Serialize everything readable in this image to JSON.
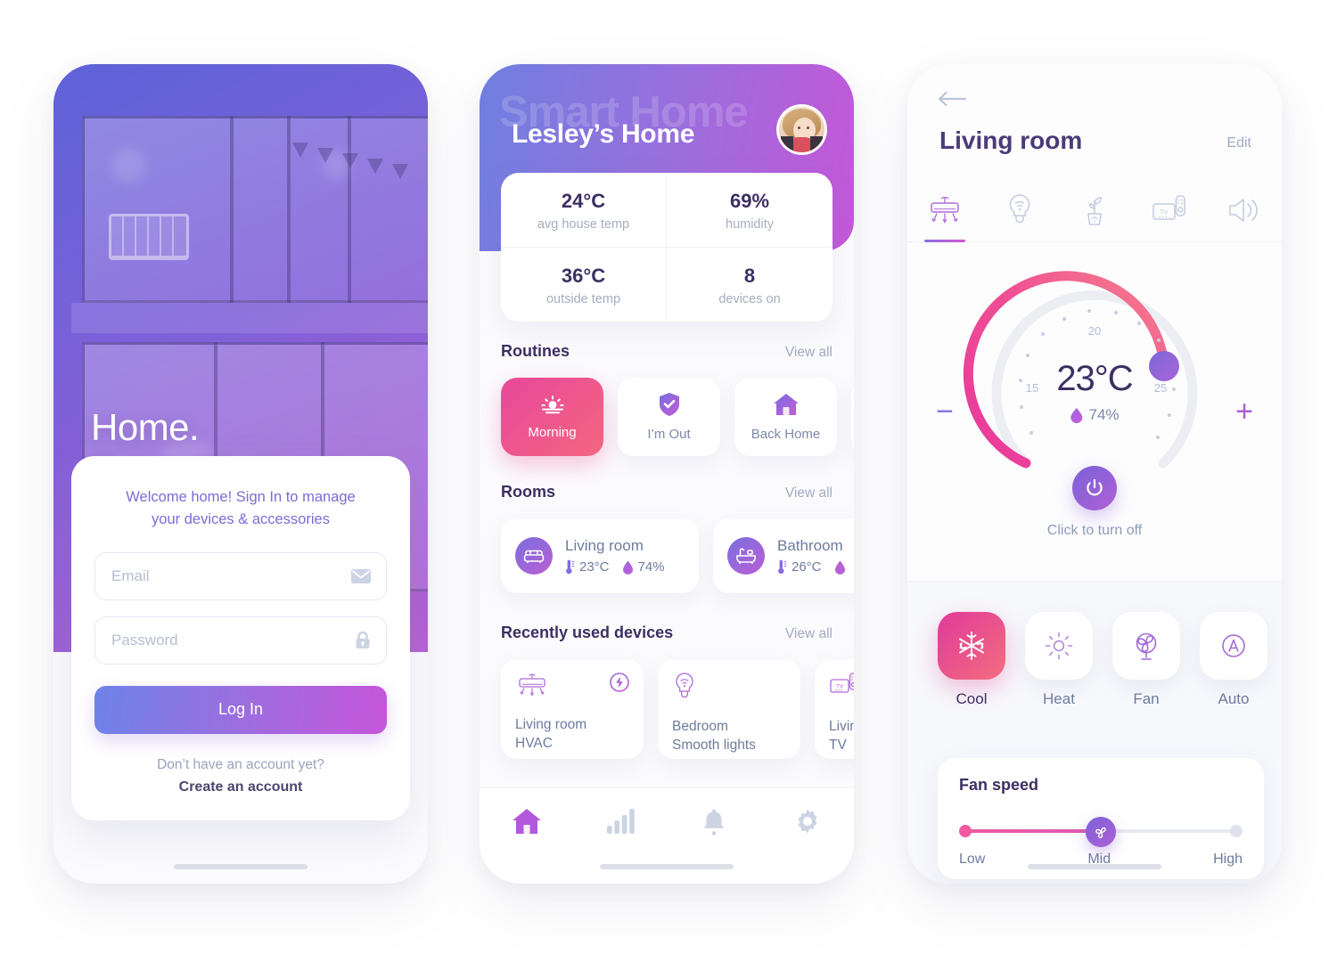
{
  "colors": {
    "brand_purple": "#8a6ce0",
    "brand_magenta": "#c457d8",
    "accent_pink": "#e8489c",
    "text_dark": "#3c2f63",
    "text_muted": "#6d7b9e",
    "bg": "#ffffff"
  },
  "login_screen": {
    "hero_title_line1": "Home.",
    "hero_title_line2": "Smart Home",
    "welcome_line1": "Welcome home! Sign In to manage",
    "welcome_line2": "your devices & accessories",
    "email_placeholder": "Email",
    "email_value": "",
    "password_placeholder": "Password",
    "password_value": "",
    "email_icon": "envelope-icon",
    "password_icon": "lock-icon",
    "login_button": "Log In",
    "signup_question": "Don’t have an account yet?",
    "signup_link": "Create an account"
  },
  "home_screen": {
    "watermark": "Smart Home",
    "title": "Lesley’s Home",
    "avatar_alt": "user-avatar",
    "stats": [
      {
        "value": "24°C",
        "label": "avg house temp"
      },
      {
        "value": "69%",
        "label": "humidity"
      },
      {
        "value": "36°C",
        "label": "outside temp"
      },
      {
        "value": "8",
        "label": "devices on"
      }
    ],
    "routines_section": {
      "title": "Routines",
      "view_all": "View all"
    },
    "routines": [
      {
        "label": "Morning",
        "icon": "sunrise-icon",
        "active": true
      },
      {
        "label": "I’m Out",
        "icon": "shield-check-icon",
        "active": false
      },
      {
        "label": "Back Home",
        "icon": "house-icon",
        "active": false
      },
      {
        "label": "",
        "icon": "",
        "active": false
      }
    ],
    "rooms_section": {
      "title": "Rooms",
      "view_all": "View all"
    },
    "rooms": [
      {
        "name": "Living room",
        "icon": "sofa-icon",
        "temp": "23°C",
        "humidity": "74%"
      },
      {
        "name": "Bathroom",
        "icon": "bathtub-icon",
        "temp": "26°C",
        "humidity": ""
      }
    ],
    "devices_section": {
      "title": "Recently used devices",
      "view_all": "View all"
    },
    "devices": [
      {
        "room": "Living room",
        "name": "HVAC",
        "icon": "hvac-icon",
        "badge": "bolt-icon"
      },
      {
        "room": "Bedroom",
        "name": "Smooth lights",
        "icon": "bulb-wifi-icon",
        "badge": ""
      },
      {
        "room": "Living",
        "name": "TV",
        "icon": "tv-remote-icon",
        "badge": ""
      }
    ],
    "tabbar": [
      {
        "icon": "home-icon",
        "active": true
      },
      {
        "icon": "stats-bars-icon",
        "active": false
      },
      {
        "icon": "bell-icon",
        "active": false
      },
      {
        "icon": "gear-icon",
        "active": false
      }
    ]
  },
  "room_screen": {
    "back_icon": "arrow-left-icon",
    "title": "Living room",
    "edit": "Edit",
    "device_tabs": [
      {
        "icon": "hvac-icon",
        "active": true
      },
      {
        "icon": "bulb-wifi-icon",
        "active": false
      },
      {
        "icon": "plant-sensor-icon",
        "active": false
      },
      {
        "icon": "tv-remote-icon",
        "active": false
      },
      {
        "icon": "speaker-icon",
        "active": false
      }
    ],
    "dial": {
      "temperature": "23°C",
      "humidity": "74%",
      "humidity_icon": "droplet-icon",
      "scale_labels": [
        "15",
        "20",
        "25"
      ],
      "scale_min": 13,
      "scale_max": 27,
      "current": 23,
      "decrease_label": "−",
      "increase_label": "+"
    },
    "power_icon": "power-icon",
    "power_label": "Click to turn off",
    "modes": [
      {
        "label": "Cool",
        "icon": "snowflake-icon",
        "active": true
      },
      {
        "label": "Heat",
        "icon": "sun-icon",
        "active": false
      },
      {
        "label": "Fan",
        "icon": "fan-icon",
        "active": false
      },
      {
        "label": "Auto",
        "icon": "auto-a-icon",
        "active": false
      }
    ],
    "fan_speed": {
      "title": "Fan speed",
      "knob_icon": "fan-blades-icon",
      "options": [
        "Low",
        "Mid",
        "High"
      ],
      "selected": "Mid",
      "selected_index": 1
    }
  }
}
